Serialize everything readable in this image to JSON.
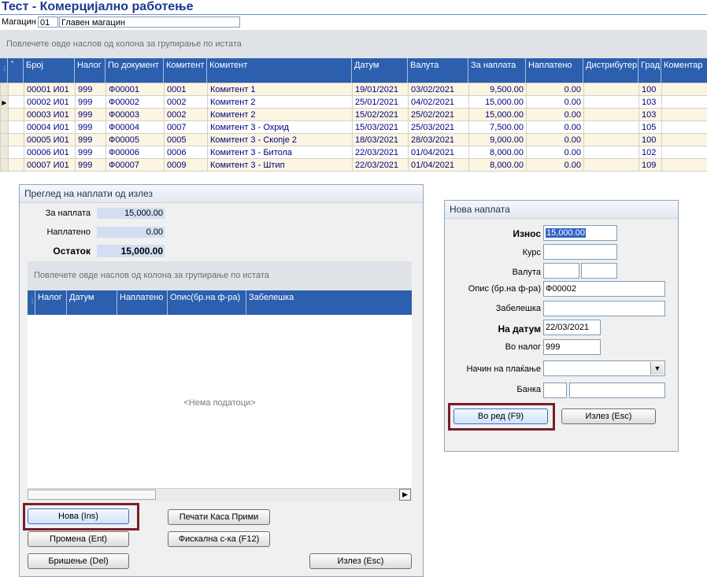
{
  "window": {
    "title": "Тест - Комерцијално работење"
  },
  "warehouse": {
    "label": "Магацин",
    "code": "01",
    "name": "Главен магацин"
  },
  "main_grid": {
    "group_hint": "Повлечете овде наслов од колона за групирање по истата",
    "columns": [
      "Број",
      "Налог",
      "По документ",
      "Комитент",
      "Комитент",
      "Датум",
      "Валута",
      "За наплата",
      "Наплатено",
      "Дистрибутер",
      "Град",
      "Коментар"
    ],
    "rows": [
      [
        "00001 И01",
        "999",
        "Ф00001",
        "0001",
        "Комитент 1",
        "19/01/2021",
        "03/02/2021",
        "9,500.00",
        "0.00",
        "",
        "100",
        ""
      ],
      [
        "00002 И01",
        "999",
        "Ф00002",
        "0002",
        "Комитент 2",
        "25/01/2021",
        "04/02/2021",
        "15,000.00",
        "0.00",
        "",
        "103",
        ""
      ],
      [
        "00003 И01",
        "999",
        "Ф00003",
        "0002",
        "Комитент 2",
        "15/02/2021",
        "25/02/2021",
        "15,000.00",
        "0.00",
        "",
        "103",
        ""
      ],
      [
        "00004 И01",
        "999",
        "Ф00004",
        "0007",
        "Комитент 3 - Охрид",
        "15/03/2021",
        "25/03/2021",
        "7,500.00",
        "0.00",
        "",
        "105",
        ""
      ],
      [
        "00005 И01",
        "999",
        "Ф00005",
        "0005",
        "Комитент 3 - Скопје 2",
        "18/03/2021",
        "28/03/2021",
        "9,000.00",
        "0.00",
        "",
        "100",
        ""
      ],
      [
        "00006 И01",
        "999",
        "Ф00006",
        "0006",
        "Комитент 3 - Битола",
        "22/03/2021",
        "01/04/2021",
        "8,000.00",
        "0.00",
        "",
        "102",
        ""
      ],
      [
        "00007 И01",
        "999",
        "Ф00007",
        "0009",
        "Комитент 3 - Штип",
        "22/03/2021",
        "01/04/2021",
        "8,000.00",
        "0.00",
        "",
        "109",
        ""
      ]
    ],
    "selected_row": 1
  },
  "payments_panel": {
    "title": "Преглед на наплати од излез",
    "to_pay_label": "За наплата",
    "to_pay_value": "15,000.00",
    "paid_label": "Наплатено",
    "paid_value": "0.00",
    "remaining_label": "Остаток",
    "remaining_value": "15,000.00",
    "group_hint": "Повлечете овде наслов од колона за групирање по истата",
    "columns": [
      "Налог",
      "Датум",
      "Наплатено",
      "Опис(бр.на ф-ра)",
      "Забелешка"
    ],
    "empty_text": "<Нема податоци>",
    "buttons": {
      "new": "Нова (Ins)",
      "edit": "Промена (Ent)",
      "delete": "Бришење (Del)",
      "print": "Печати Каса Прими",
      "fiscal": "Фискална с-ка (F12)",
      "exit": "Излез (Esc)"
    }
  },
  "new_payment_dialog": {
    "title": "Нова наплата",
    "amount_label": "Износ",
    "amount_value": "15,000.00",
    "rate_label": "Курс",
    "rate_value": "",
    "currency_label": "Валута",
    "desc_label": "Опис (бр.на ф-ра)",
    "desc_value": "Ф00002",
    "note_label": "Забелешка",
    "note_value": "",
    "date_label": "На датум",
    "date_value": "22/03/2021",
    "order_label": "Во налог",
    "order_value": "999",
    "method_label": "Начин на плаќање",
    "method_value": "",
    "bank_label": "Банка",
    "ok_button": "Во ред (F9)",
    "exit_button": "Излез (Esc)"
  }
}
